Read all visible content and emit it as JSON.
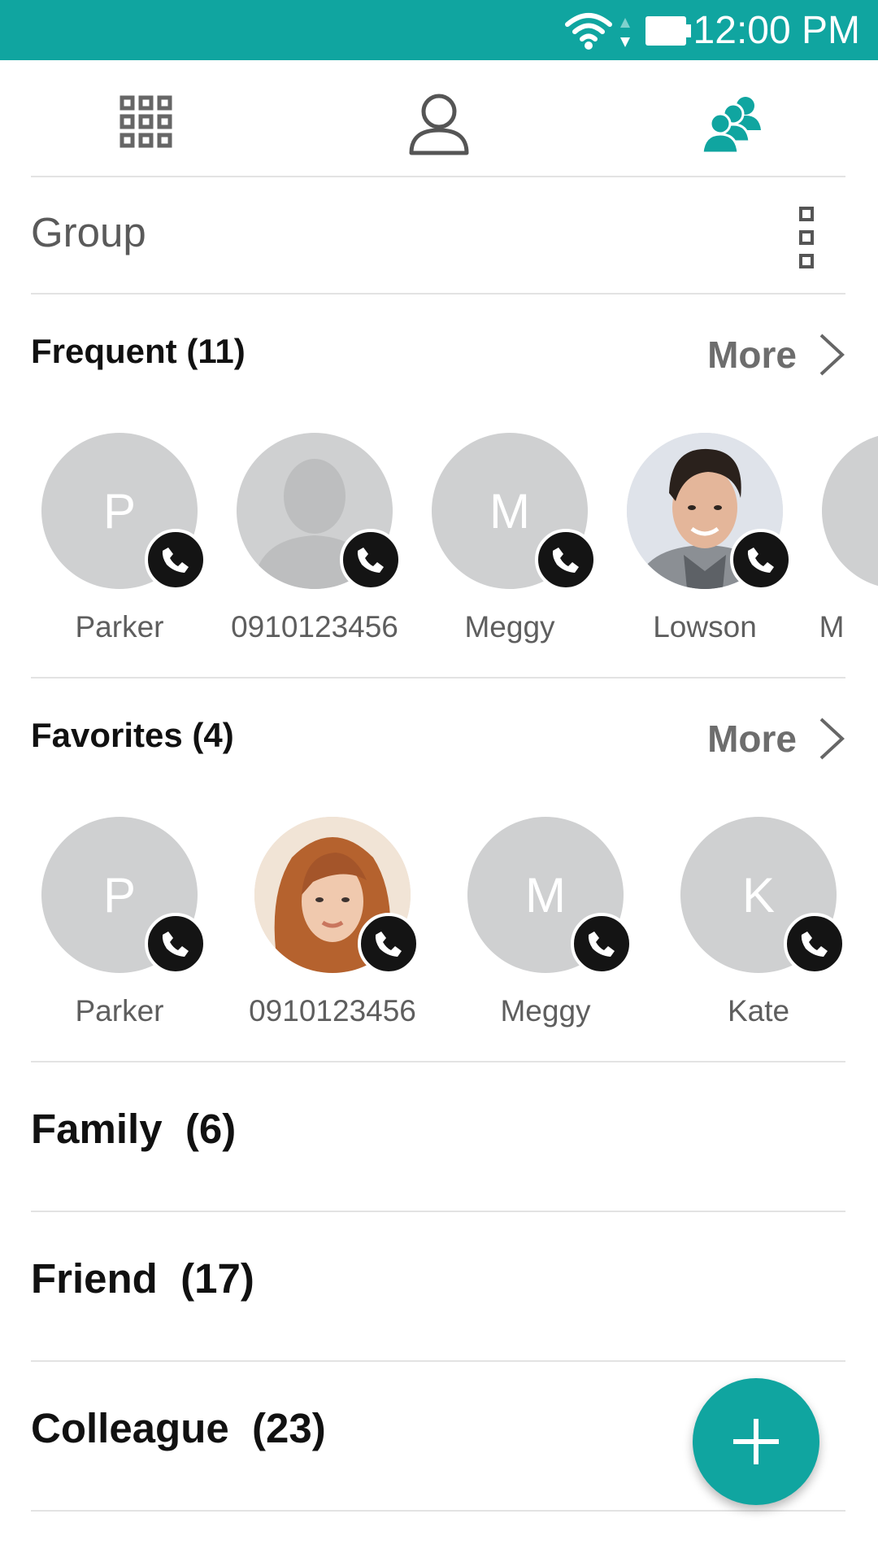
{
  "status_bar": {
    "time": "12:00 PM",
    "bg_color": "#10a5a0"
  },
  "tabs": [
    {
      "icon": "grid-icon",
      "active": false
    },
    {
      "icon": "person-icon",
      "active": false
    },
    {
      "icon": "group-icon",
      "active": true
    }
  ],
  "header": {
    "title": "Group",
    "menu_icon": "overflow-menu-icon"
  },
  "frequent": {
    "title": "Frequent (11)",
    "more_label": "More",
    "contacts": [
      {
        "name": "Parker",
        "initial": "P",
        "type": "initial"
      },
      {
        "name": "0910123456",
        "initial": "",
        "type": "silhouette"
      },
      {
        "name": "Meggy",
        "initial": "M",
        "type": "initial"
      },
      {
        "name": "Lowson",
        "initial": "",
        "type": "photo"
      },
      {
        "name": "M",
        "initial": "",
        "type": "initial"
      }
    ]
  },
  "favorites": {
    "title": "Favorites (4)",
    "more_label": "More",
    "contacts": [
      {
        "name": "Parker",
        "initial": "P",
        "type": "initial"
      },
      {
        "name": "0910123456",
        "initial": "",
        "type": "photo"
      },
      {
        "name": "Meggy",
        "initial": "M",
        "type": "initial"
      },
      {
        "name": "Kate",
        "initial": "K",
        "type": "initial"
      }
    ]
  },
  "groups": [
    {
      "label": "Family  (6)"
    },
    {
      "label": "Friend  (17)"
    },
    {
      "label": "Colleague  (23)"
    }
  ],
  "fab": {
    "icon": "plus-icon",
    "color": "#10a5a0"
  }
}
